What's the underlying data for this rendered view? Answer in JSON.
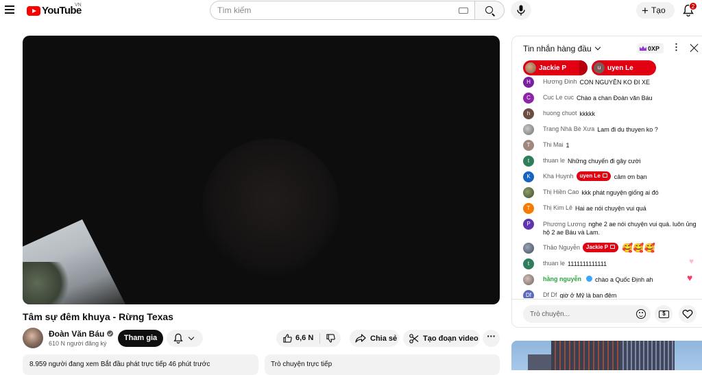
{
  "header": {
    "logo_text": "YouTube",
    "region": "VN",
    "search_placeholder": "Tìm kiếm",
    "create_label": "Tạo",
    "notification_count": "2"
  },
  "video": {
    "title": "Tâm sự đêm khuya - Rừng Texas",
    "channel_name": "Đoàn Văn Báu",
    "subscribers": "610 N người đăng ký",
    "join_label": "Tham gia",
    "like_count": "6,6 N",
    "share_label": "Chia sẻ",
    "clip_label": "Tạo đoạn video",
    "info_text": "8.959 người đang xem  Bắt đầu phát trực tiếp 46 phút trước",
    "live_chat_label": "Trò chuyện trực tiếp"
  },
  "chat": {
    "title": "Tin nhắn hàng đầu",
    "xp": "0XP",
    "tickers": [
      {
        "name": "Jackie P",
        "avatar": ""
      },
      {
        "name": "uyen Le",
        "avatar": "u"
      }
    ],
    "messages": [
      {
        "avatar": "H",
        "avatar_color": "#7b1fa2",
        "author": "Hương Đinh",
        "text": "CON NGUYÊN KO ĐI XE"
      },
      {
        "avatar": "C",
        "avatar_color": "#8e24aa",
        "author": "Cuc Le cuc",
        "text": "Chào a chan Đoàn văn Báu"
      },
      {
        "avatar": "h",
        "avatar_color": "#6d4c41",
        "author": "huong chuot",
        "text": "kkkkk"
      },
      {
        "avatar": "",
        "avatar_color": "#9e9e9e",
        "author": "Trang Nhà Bè Xưa",
        "text": "Lam đi du thuyen ko ?"
      },
      {
        "avatar": "T",
        "avatar_color": "#a1887f",
        "author": "Thi Mai",
        "text": "1"
      },
      {
        "avatar": "t",
        "avatar_color": "#2e7d5b",
        "author": "thuan le",
        "text": "Những chuyến đi gây cười"
      },
      {
        "avatar": "K",
        "avatar_color": "#1565c0",
        "author": "Kha Huynh",
        "mention": "uyen Le",
        "text": "cảm ơn bạn"
      },
      {
        "avatar": "",
        "avatar_color": "#6d7a4f",
        "author": "Thị Hiền Cao",
        "text": "kkk phát nguyện giống ai đó"
      },
      {
        "avatar": "T",
        "avatar_color": "#f57c00",
        "author": "Thị Kim Lê",
        "text": "Hai ae nói chuyện vui quá"
      },
      {
        "avatar": "P",
        "avatar_color": "#5e35b1",
        "author": "Phương Lương",
        "text": "nghe 2 ae nói chuyện vui quá. luôn ủng hộ 2 ae Báu và Lam."
      },
      {
        "avatar": "",
        "avatar_color": "#5d6d7e",
        "author": "Thảo Nguyễn",
        "mention": "Jackie P",
        "text": "🥰🥰🥰"
      },
      {
        "avatar": "t",
        "avatar_color": "#2e7d5b",
        "author": "thuan le",
        "text": "1111111111111"
      },
      {
        "avatar": "",
        "avatar_color": "#8d8d8d",
        "author": "hằng nguyễn",
        "verified": true,
        "text": "chào a Quốc Định ah"
      },
      {
        "avatar": "Df",
        "avatar_color": "#5c6bc0",
        "author": "Df Df",
        "text": "giờ ở Mỹ là ban đêm"
      }
    ],
    "input_placeholder": "Trò chuyện..."
  }
}
